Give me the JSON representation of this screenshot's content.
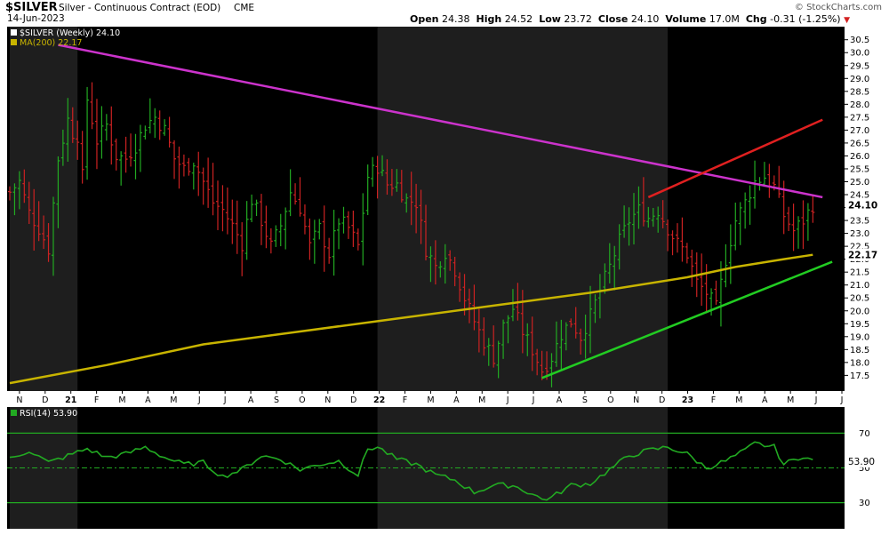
{
  "header": {
    "symbol": "$SILVER",
    "description": "Silver - Continuous Contract (EOD)",
    "exchange": "CME",
    "watermark": "© StockCharts.com",
    "date": "14-Jun-2023",
    "open_label": "Open",
    "open": "24.38",
    "high_label": "High",
    "high": "24.52",
    "low_label": "Low",
    "low": "23.72",
    "close_label": "Close",
    "close": "24.10",
    "volume_label": "Volume",
    "volume": "17.0M",
    "chg_label": "Chg",
    "chg": "-0.31 (-1.25%)"
  },
  "chart_data": [
    {
      "type": "ohlc",
      "legend": [
        {
          "label": "$SILVER (Weekly) 24.10",
          "color": "#ffffff"
        },
        {
          "label": "MA(200) 22.17",
          "color": "#c8b400"
        }
      ],
      "last_price_label": "24.10",
      "ma_label": "22.17",
      "y_ticks": [
        "30.5",
        "30.0",
        "29.5",
        "29.0",
        "28.5",
        "28.0",
        "27.5",
        "27.0",
        "26.5",
        "26.0",
        "25.5",
        "25.0",
        "24.5",
        "24.0",
        "23.5",
        "23.0",
        "22.5",
        "22.0",
        "21.5",
        "21.0",
        "20.5",
        "20.0",
        "19.5",
        "19.0",
        "18.5",
        "18.0",
        "17.5"
      ],
      "ylim": [
        17.1,
        30.8
      ],
      "x_ticks": [
        "N",
        "D",
        "21",
        "F",
        "M",
        "A",
        "M",
        "J",
        "J",
        "A",
        "S",
        "O",
        "N",
        "D",
        "22",
        "F",
        "M",
        "A",
        "M",
        "J",
        "J",
        "A",
        "S",
        "O",
        "N",
        "D",
        "23",
        "F",
        "M",
        "A",
        "M",
        "J",
        "J"
      ],
      "series": [
        {
          "name": "$SILVER (Weekly)",
          "close_path": [
            [
              0,
              24.6
            ],
            [
              2,
              25.0
            ],
            [
              4,
              23.8
            ],
            [
              6,
              23.2
            ],
            [
              8,
              22.4
            ],
            [
              10,
              25.9
            ],
            [
              12,
              27.4
            ],
            [
              13,
              26.9
            ],
            [
              14,
              26.8
            ],
            [
              15,
              25.2
            ],
            [
              16,
              28.2
            ],
            [
              18,
              26.6
            ],
            [
              20,
              27.2
            ],
            [
              22,
              26.0
            ],
            [
              24,
              25.9
            ],
            [
              26,
              26.4
            ],
            [
              28,
              27.2
            ],
            [
              30,
              27.5
            ],
            [
              32,
              27.0
            ],
            [
              34,
              25.9
            ],
            [
              36,
              25.5
            ],
            [
              38,
              25.8
            ],
            [
              40,
              25.0
            ],
            [
              42,
              24.2
            ],
            [
              44,
              23.9
            ],
            [
              46,
              23.3
            ],
            [
              48,
              22.6
            ],
            [
              50,
              24.3
            ],
            [
              52,
              23.5
            ],
            [
              54,
              22.5
            ],
            [
              56,
              23.3
            ],
            [
              58,
              24.6
            ],
            [
              60,
              24.0
            ],
            [
              62,
              22.5
            ],
            [
              64,
              23.2
            ],
            [
              66,
              22.2
            ],
            [
              68,
              23.5
            ],
            [
              70,
              23.2
            ],
            [
              72,
              22.5
            ],
            [
              74,
              25.2
            ],
            [
              76,
              25.6
            ],
            [
              78,
              24.9
            ],
            [
              80,
              24.9
            ],
            [
              82,
              24.3
            ],
            [
              84,
              24.2
            ],
            [
              86,
              22.4
            ],
            [
              88,
              21.7
            ],
            [
              90,
              22.3
            ],
            [
              92,
              21.6
            ],
            [
              94,
              20.5
            ],
            [
              96,
              19.6
            ],
            [
              98,
              18.8
            ],
            [
              100,
              18.2
            ],
            [
              102,
              19.4
            ],
            [
              104,
              20.1
            ],
            [
              106,
              19.2
            ],
            [
              108,
              18.5
            ],
            [
              110,
              17.7
            ],
            [
              112,
              18.2
            ],
            [
              114,
              19.1
            ],
            [
              116,
              19.6
            ],
            [
              118,
              19.0
            ],
            [
              120,
              19.8
            ],
            [
              122,
              20.8
            ],
            [
              124,
              21.7
            ],
            [
              126,
              22.7
            ],
            [
              128,
              23.5
            ],
            [
              130,
              23.9
            ],
            [
              132,
              23.6
            ],
            [
              134,
              23.9
            ],
            [
              136,
              23.2
            ],
            [
              138,
              22.6
            ],
            [
              140,
              22.2
            ],
            [
              142,
              21.1
            ],
            [
              144,
              20.7
            ],
            [
              146,
              20.1
            ],
            [
              148,
              22.0
            ],
            [
              150,
              23.5
            ],
            [
              152,
              24.2
            ],
            [
              154,
              25.0
            ],
            [
              156,
              25.2
            ],
            [
              158,
              24.8
            ],
            [
              160,
              23.7
            ],
            [
              162,
              23.1
            ],
            [
              164,
              23.5
            ],
            [
              166,
              24.1
            ]
          ],
          "color": "#22aa22"
        },
        {
          "name": "MA(200)",
          "points": [
            [
              0,
              17.2
            ],
            [
              20,
              17.9
            ],
            [
              40,
              18.7
            ],
            [
              60,
              19.2
            ],
            [
              80,
              19.7
            ],
            [
              100,
              20.2
            ],
            [
              120,
              20.7
            ],
            [
              140,
              21.3
            ],
            [
              150,
              21.7
            ],
            [
              160,
              22.0
            ],
            [
              166,
              22.17
            ]
          ],
          "color": "#c8b400"
        }
      ],
      "trendlines": [
        {
          "name": "resistance",
          "color": "#cc33cc",
          "from": [
            10,
            30.3
          ],
          "to": [
            168,
            24.4
          ]
        },
        {
          "name": "upper-channel",
          "color": "#e02020",
          "from": [
            132,
            24.4
          ],
          "to": [
            168,
            27.4
          ]
        },
        {
          "name": "support",
          "color": "#22cc22",
          "from": [
            110,
            17.4
          ],
          "to": [
            170,
            21.9
          ]
        }
      ],
      "highlight_bands": [
        [
          0,
          14
        ],
        [
          76,
          136
        ]
      ]
    },
    {
      "type": "line",
      "legend": [
        {
          "label": "RSI(14) 53.90",
          "color": "#22aa22"
        }
      ],
      "last_label": "53.90",
      "y_ticks": [
        "70",
        "50",
        "30"
      ],
      "ylim": [
        15,
        85
      ],
      "reference_lines": [
        70,
        30
      ],
      "series": [
        {
          "name": "RSI(14)",
          "points": [
            [
              0,
              55
            ],
            [
              4,
              60
            ],
            [
              8,
              53
            ],
            [
              12,
              57
            ],
            [
              16,
              61
            ],
            [
              20,
              56
            ],
            [
              24,
              58
            ],
            [
              28,
              62
            ],
            [
              32,
              56
            ],
            [
              36,
              52
            ],
            [
              40,
              53
            ],
            [
              44,
              45
            ],
            [
              48,
              49
            ],
            [
              52,
              57
            ],
            [
              56,
              55
            ],
            [
              60,
              49
            ],
            [
              64,
              52
            ],
            [
              68,
              54
            ],
            [
              72,
              46
            ],
            [
              74,
              61
            ],
            [
              76,
              62
            ],
            [
              80,
              55
            ],
            [
              84,
              52
            ],
            [
              88,
              46
            ],
            [
              92,
              43
            ],
            [
              96,
              36
            ],
            [
              100,
              40
            ],
            [
              104,
              40
            ],
            [
              108,
              35
            ],
            [
              110,
              32
            ],
            [
              112,
              33
            ],
            [
              116,
              40
            ],
            [
              120,
              41
            ],
            [
              124,
              49
            ],
            [
              128,
              57
            ],
            [
              132,
              60
            ],
            [
              136,
              62
            ],
            [
              140,
              58
            ],
            [
              144,
              50
            ],
            [
              148,
              54
            ],
            [
              152,
              60
            ],
            [
              154,
              64
            ],
            [
              158,
              62
            ],
            [
              160,
              52
            ],
            [
              164,
              57
            ],
            [
              166,
              53.9
            ]
          ],
          "color": "#22aa22"
        }
      ]
    }
  ]
}
